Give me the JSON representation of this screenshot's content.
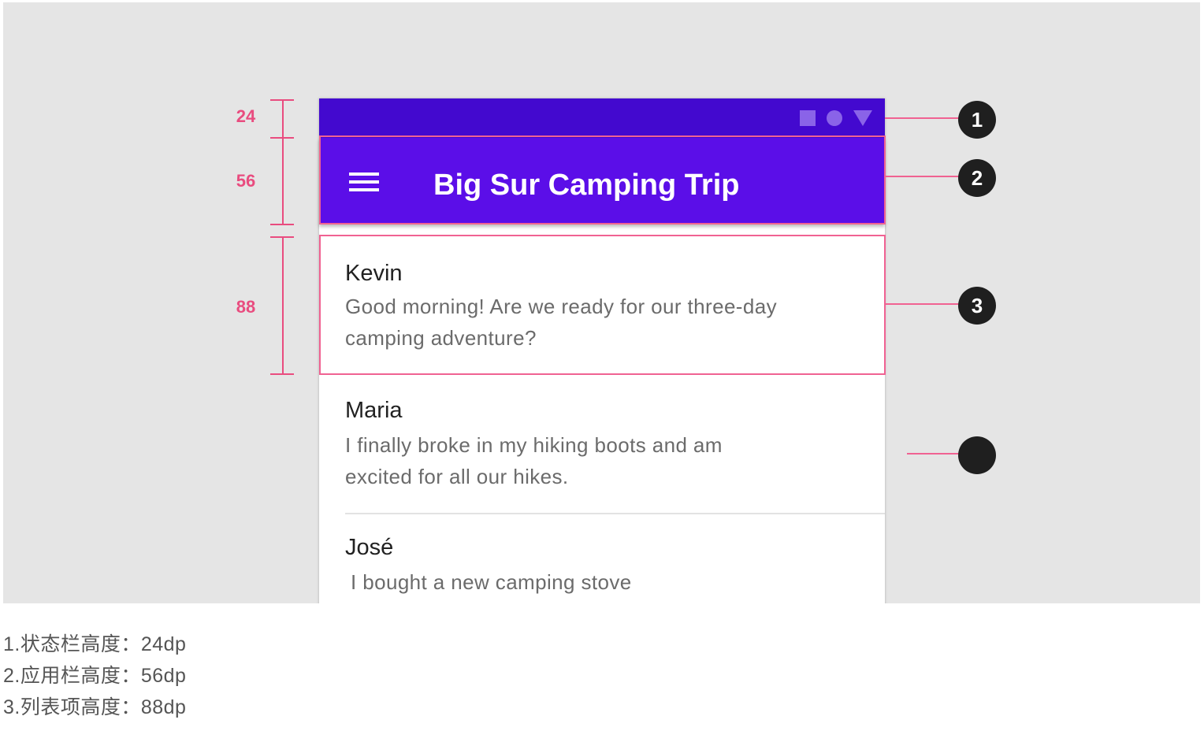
{
  "phone": {
    "app_title": "Big Sur Camping Trip",
    "list": [
      {
        "name": "Kevin",
        "text": "Good morning! Are we ready for our three-day camping adventure?"
      },
      {
        "name": "Maria",
        "text": "I finally broke in my hiking boots and am excited for all our hikes."
      },
      {
        "name": "José",
        "text": "I bought a new camping stove"
      }
    ]
  },
  "dimensions": {
    "status_bar": "24",
    "app_bar": "56",
    "list_item": "88"
  },
  "callouts": [
    "1",
    "2",
    "3",
    ""
  ],
  "captions": [
    "1.状态栏高度：24dp",
    "2.应用栏高度：56dp",
    "3.列表项高度：88dp"
  ],
  "colors": {
    "status_bar": "#4309cf",
    "app_bar": "#5b0ee8",
    "annotation": "#e94c7f",
    "callout": "#1f1f1f"
  }
}
